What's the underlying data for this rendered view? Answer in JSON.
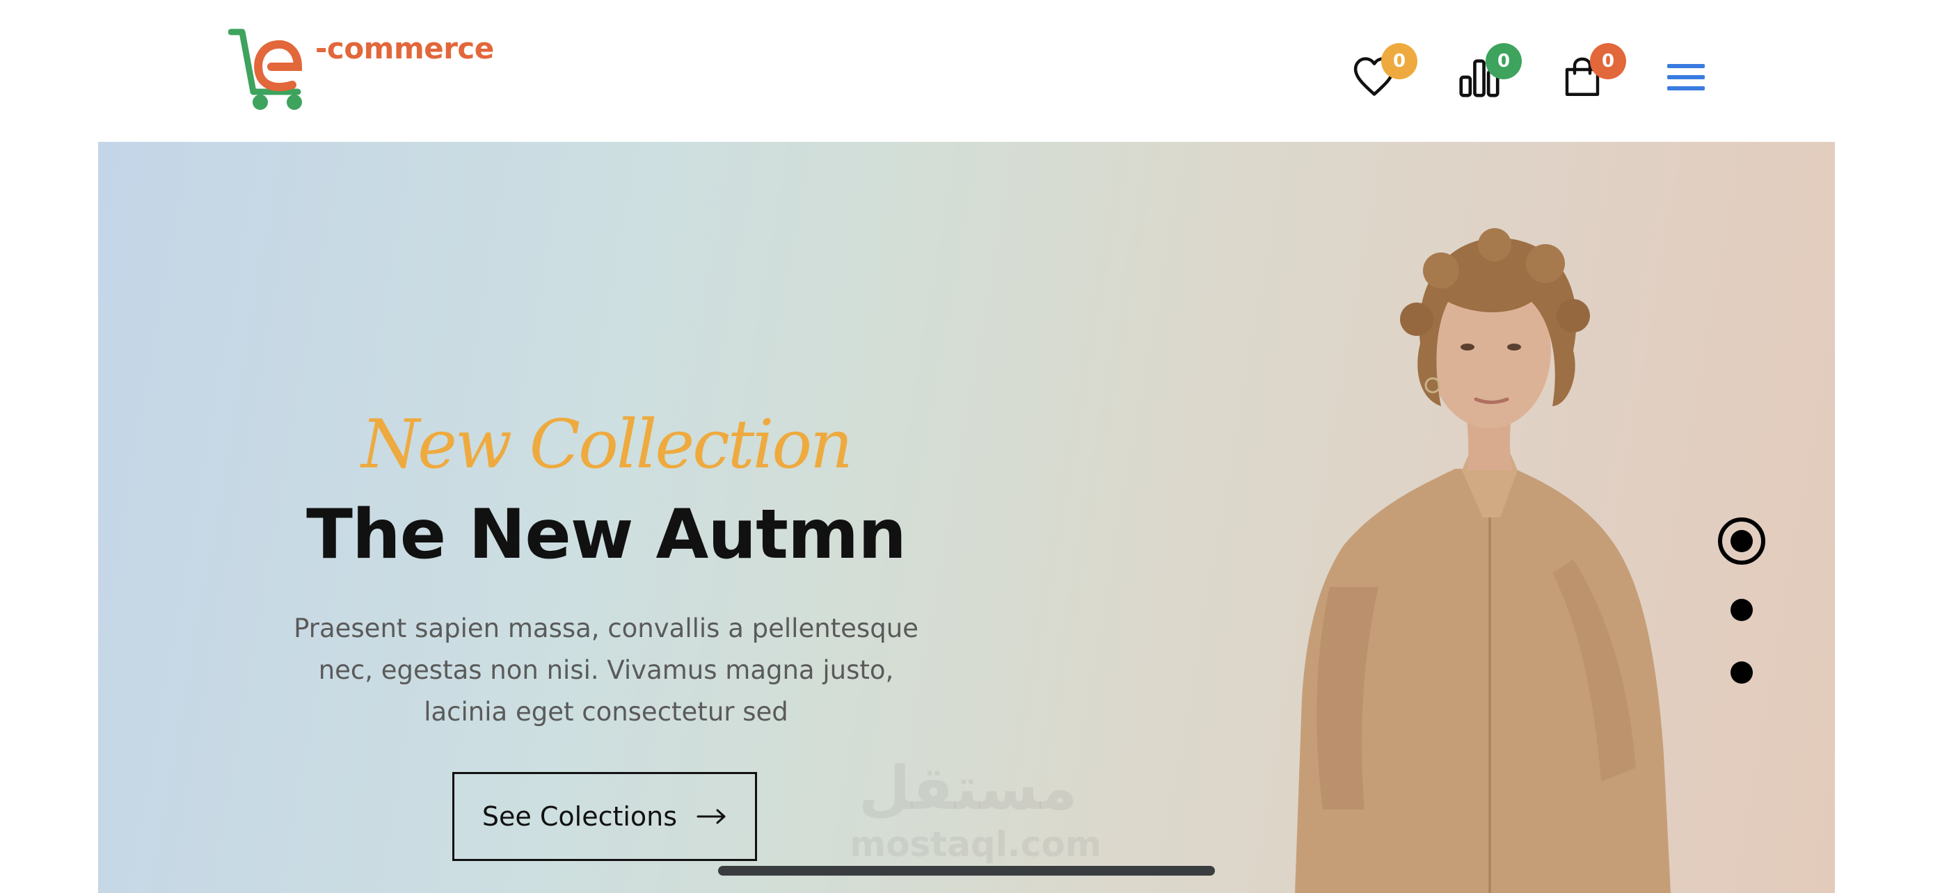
{
  "header": {
    "logo_text": "-commerce",
    "wishlist_count": "0",
    "compare_count": "0",
    "cart_count": "0",
    "icons": [
      "heart-icon",
      "bar-chart-icon",
      "shopping-bag-icon",
      "hamburger-menu-icon"
    ],
    "colors": {
      "wishlist_badge": "#eeaa3e",
      "compare_badge": "#3da35d",
      "cart_badge": "#e2673a",
      "menu_icon": "#3a7be0",
      "logo_green": "#3da35d",
      "logo_orange": "#e2673a"
    }
  },
  "hero": {
    "eyebrow": "New Collection",
    "title": "The New Autmn",
    "description": "Praesent sapien massa, convallis a pellentesque nec, egestas non nisi. Vivamus magna justo, lacinia eget consectetur sed",
    "cta_label": "See Colections",
    "slides": {
      "total": 3,
      "active": 1
    }
  },
  "watermark": {
    "arabic": "مستقل",
    "latin": "mostaql.com"
  }
}
